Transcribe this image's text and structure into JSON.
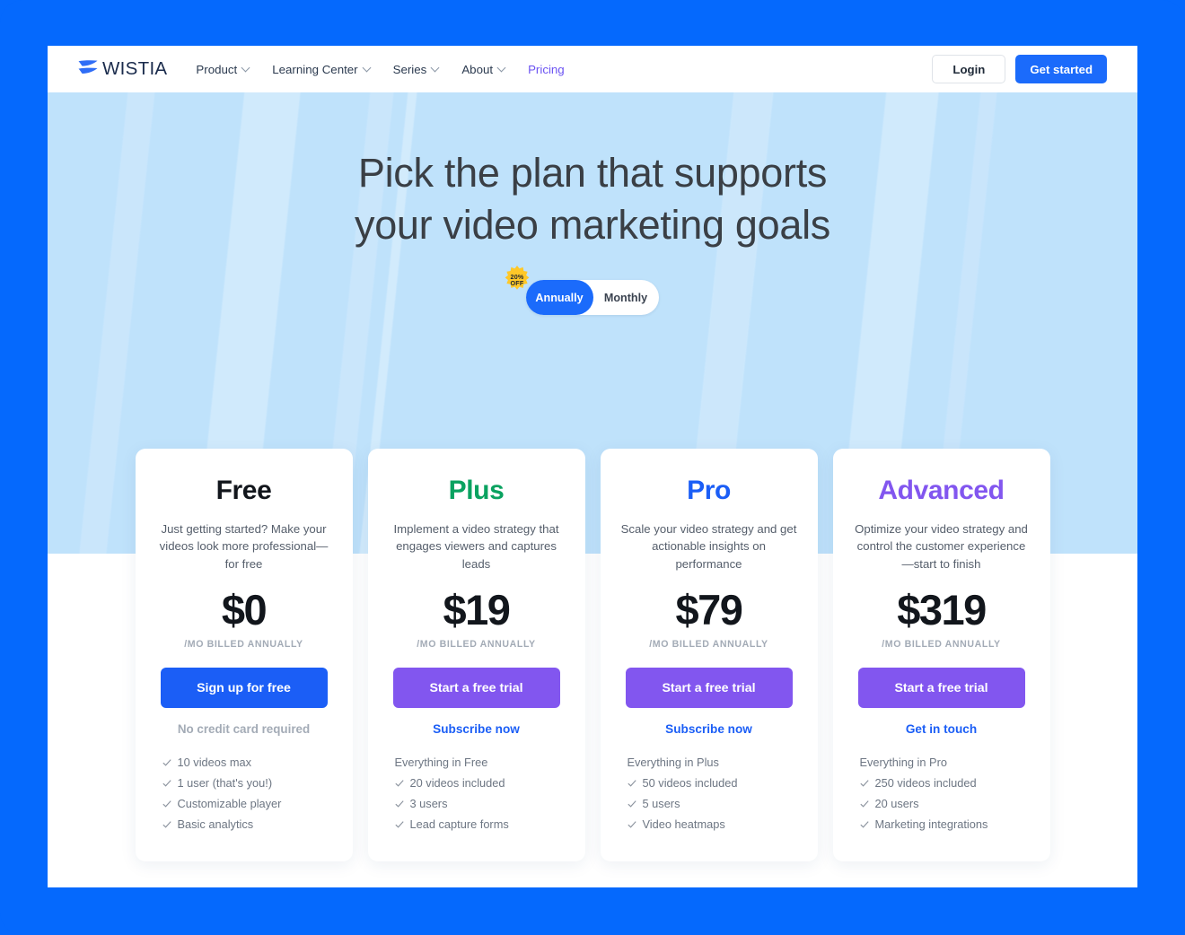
{
  "brand": {
    "word": "WISTIA",
    "logo_icon": "wistia-wing-logo"
  },
  "nav": {
    "links": [
      {
        "label": "Product",
        "has_caret": true,
        "accent": false
      },
      {
        "label": "Learning Center",
        "has_caret": true,
        "accent": false
      },
      {
        "label": "Series",
        "has_caret": true,
        "accent": false
      },
      {
        "label": "About",
        "has_caret": true,
        "accent": false
      },
      {
        "label": "Pricing",
        "has_caret": false,
        "accent": true
      }
    ],
    "login_label": "Login",
    "get_started_label": "Get started"
  },
  "hero": {
    "title_line1": "Pick the plan that supports",
    "title_line2": "your video marketing goals"
  },
  "billing_toggle": {
    "annually_label": "Annually",
    "monthly_label": "Monthly",
    "selected": "Annually",
    "badge_line1": "20%",
    "badge_line2": "OFF"
  },
  "plans": [
    {
      "name": "Free",
      "name_color": "#12161c",
      "description": "Just getting started? Make your videos look more professional—for free",
      "price": "$0",
      "period": "/MO BILLED ANNUALLY",
      "cta_label": "Sign up for free",
      "cta_style": "blue",
      "note": "No credit card required",
      "note_type": "text",
      "feature_head": "",
      "features": [
        "10 videos max",
        "1 user (that's you!)",
        "Customizable player",
        "Basic analytics"
      ]
    },
    {
      "name": "Plus",
      "name_color": "#0aa260",
      "description": "Implement a video strategy that engages viewers and captures leads",
      "price": "$19",
      "period": "/MO BILLED ANNUALLY",
      "cta_label": "Start a free trial",
      "cta_style": "purple",
      "note": "Subscribe now",
      "note_type": "link",
      "feature_head": "Everything in Free",
      "features": [
        "20 videos included",
        "3 users",
        "Lead capture forms"
      ]
    },
    {
      "name": "Pro",
      "name_color": "#1b5ef6",
      "description": "Scale your video strategy and get actionable insights on performance",
      "price": "$79",
      "period": "/MO BILLED ANNUALLY",
      "cta_label": "Start a free trial",
      "cta_style": "purple",
      "note": "Subscribe now",
      "note_type": "link",
      "feature_head": "Everything in Plus",
      "features": [
        "50 videos included",
        "5 users",
        "Video heatmaps"
      ]
    },
    {
      "name": "Advanced",
      "name_color": "#8256ef",
      "description": "Optimize your video strategy and control the customer experience—start to finish",
      "price": "$319",
      "period": "/MO BILLED ANNUALLY",
      "cta_label": "Start a free trial",
      "cta_style": "purple",
      "note": "Get in touch",
      "note_type": "link",
      "feature_head": "Everything in Pro",
      "features": [
        "250 videos included",
        "20 users",
        "Marketing integrations"
      ]
    }
  ],
  "colors": {
    "page_background": "#0569fd",
    "hero_background": "#bfe2fb",
    "primary_blue": "#1b6bfb",
    "purple": "#8256ef",
    "green": "#0aa260",
    "badge_yellow": "#ffc828"
  }
}
